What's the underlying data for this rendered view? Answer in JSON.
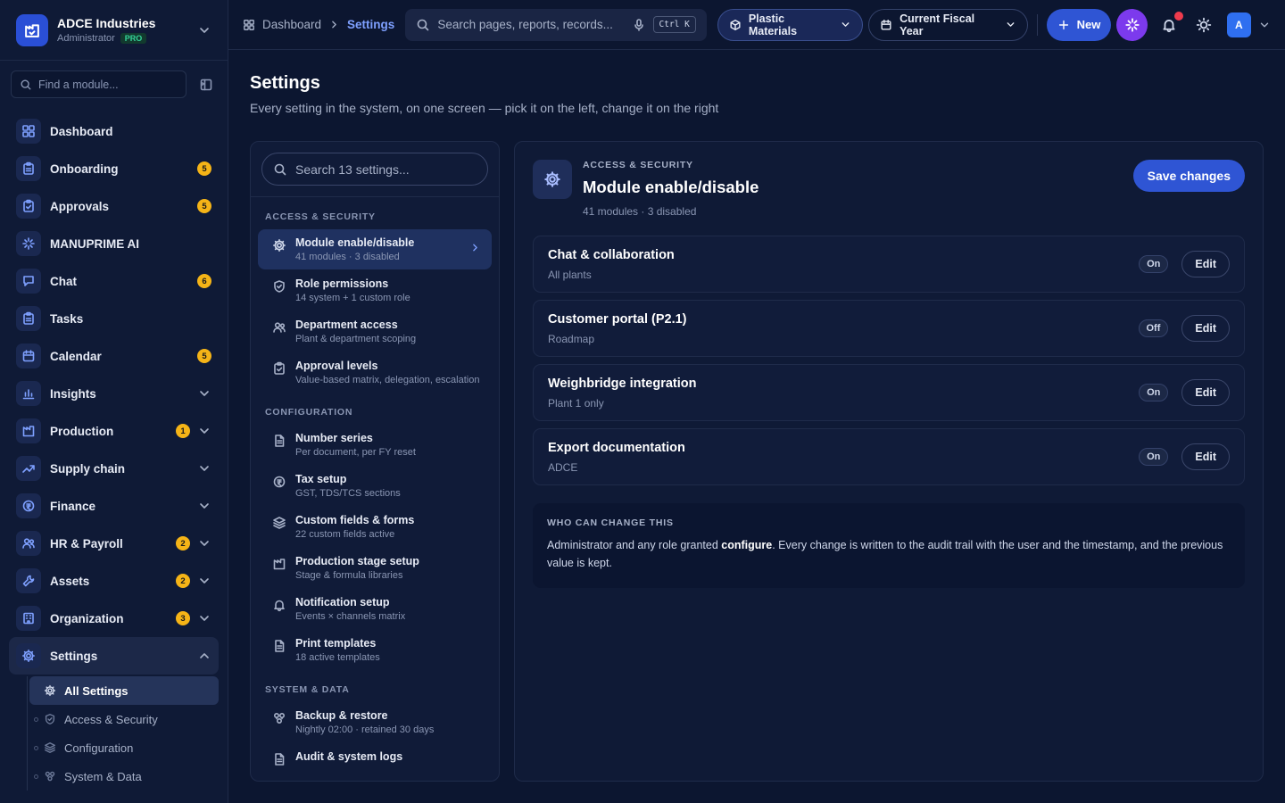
{
  "org": {
    "name": "ADCE Industries",
    "role": "Administrator",
    "plan": "PRO"
  },
  "sidebar": {
    "find_placeholder": "Find a module...",
    "items": [
      {
        "label": "Dashboard",
        "icon": "dashboard-icon",
        "badge": null,
        "expandable": false
      },
      {
        "label": "Onboarding",
        "icon": "clipboard-icon",
        "badge": "5",
        "expandable": false
      },
      {
        "label": "Approvals",
        "icon": "clipboard-check-icon",
        "badge": "5",
        "expandable": false
      },
      {
        "label": "MANUPRIME AI",
        "icon": "sparkle-icon",
        "badge": null,
        "expandable": false
      },
      {
        "label": "Chat",
        "icon": "chat-icon",
        "badge": "6",
        "expandable": false
      },
      {
        "label": "Tasks",
        "icon": "tasks-icon",
        "badge": null,
        "expandable": false
      },
      {
        "label": "Calendar",
        "icon": "calendar-icon",
        "badge": "5",
        "expandable": false
      },
      {
        "label": "Insights",
        "icon": "bar-chart-icon",
        "badge": null,
        "expandable": true
      },
      {
        "label": "Production",
        "icon": "factory-icon",
        "badge": "1",
        "expandable": true
      },
      {
        "label": "Supply chain",
        "icon": "trend-icon",
        "badge": null,
        "expandable": true
      },
      {
        "label": "Finance",
        "icon": "coin-icon",
        "badge": null,
        "expandable": true
      },
      {
        "label": "HR & Payroll",
        "icon": "people-icon",
        "badge": "2",
        "expandable": true
      },
      {
        "label": "Assets",
        "icon": "wrench-icon",
        "badge": "2",
        "expandable": true
      },
      {
        "label": "Organization",
        "icon": "building-icon",
        "badge": "3",
        "expandable": true
      },
      {
        "label": "Settings",
        "icon": "gear-icon",
        "badge": null,
        "expandable": true
      }
    ],
    "settings_sub": [
      {
        "label": "All Settings",
        "icon": "gear-icon",
        "active": true
      },
      {
        "label": "Access & Security",
        "icon": "shield-icon",
        "active": false
      },
      {
        "label": "Configuration",
        "icon": "layers-icon",
        "active": false
      },
      {
        "label": "System & Data",
        "icon": "database-icon",
        "active": false
      }
    ]
  },
  "topbar": {
    "crumb_root": "Dashboard",
    "crumb_current": "Settings",
    "search_placeholder": "Search pages, reports, records...",
    "shortcut": "Ctrl K",
    "company": "Plastic Materials",
    "period": "Current Fiscal Year",
    "new_label": "New",
    "avatar_initial": "A"
  },
  "page": {
    "title": "Settings",
    "subtitle": "Every setting in the system, on one screen — pick it on the left, change it on the right"
  },
  "settings_nav": {
    "search_placeholder": "Search 13 settings...",
    "sections": [
      {
        "title": "ACCESS & SECURITY",
        "items": [
          {
            "name": "Module enable/disable",
            "desc": "41 modules · 3 disabled",
            "icon": "gear-icon",
            "active": true
          },
          {
            "name": "Role permissions",
            "desc": "14 system + 1 custom role",
            "icon": "shield-icon",
            "active": false
          },
          {
            "name": "Department access",
            "desc": "Plant & department scoping",
            "icon": "people-icon",
            "active": false
          },
          {
            "name": "Approval levels",
            "desc": "Value-based matrix, delegation, escalation",
            "icon": "clipboard-check-icon",
            "active": false
          }
        ]
      },
      {
        "title": "CONFIGURATION",
        "items": [
          {
            "name": "Number series",
            "desc": "Per document, per FY reset",
            "icon": "document-icon",
            "active": false
          },
          {
            "name": "Tax setup",
            "desc": "GST, TDS/TCS sections",
            "icon": "coin-icon",
            "active": false
          },
          {
            "name": "Custom fields & forms",
            "desc": "22 custom fields active",
            "icon": "layers-icon",
            "active": false
          },
          {
            "name": "Production stage setup",
            "desc": "Stage & formula libraries",
            "icon": "factory-icon",
            "active": false
          },
          {
            "name": "Notification setup",
            "desc": "Events × channels matrix",
            "icon": "bell-icon",
            "active": false
          },
          {
            "name": "Print templates",
            "desc": "18 active templates",
            "icon": "document-icon",
            "active": false
          }
        ]
      },
      {
        "title": "SYSTEM & DATA",
        "items": [
          {
            "name": "Backup & restore",
            "desc": "Nightly 02:00 · retained 30 days",
            "icon": "database-icon",
            "active": false
          },
          {
            "name": "Audit & system logs",
            "desc": "",
            "icon": "document-icon",
            "active": false
          }
        ]
      }
    ]
  },
  "detail": {
    "kicker": "ACCESS & SECURITY",
    "title": "Module enable/disable",
    "meta": "41 modules · 3 disabled",
    "save_label": "Save changes",
    "edit_label": "Edit",
    "modules": [
      {
        "name": "Chat & collaboration",
        "scope": "All plants",
        "state": "On"
      },
      {
        "name": "Customer portal (P2.1)",
        "scope": "Roadmap",
        "state": "Off"
      },
      {
        "name": "Weighbridge integration",
        "scope": "Plant 1 only",
        "state": "On"
      },
      {
        "name": "Export documentation",
        "scope": "ADCE",
        "state": "On"
      }
    ],
    "who": {
      "kicker": "WHO CAN CHANGE THIS",
      "text_pre": "Administrator and any role granted ",
      "text_bold": "configure",
      "text_post": ". Every change is written to the audit trail with the user and the timestamp, and the previous value is kept."
    }
  },
  "colors": {
    "accent": "#2f55d4",
    "badge": "#f5b417",
    "ai": "#7c3aed",
    "notif": "#ef3b4d",
    "bg": "#0c1630"
  }
}
